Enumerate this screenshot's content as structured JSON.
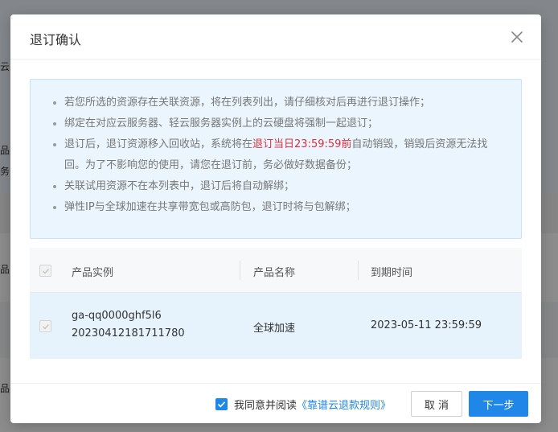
{
  "background": {
    "fragments": [
      "云图",
      "品类",
      "务",
      "品",
      "品类"
    ]
  },
  "dialog": {
    "title": "退订确认",
    "close_icon": "close-icon",
    "notice": {
      "items": [
        {
          "text": "若您所选的资源存在关联资源，将在列表列出，请仔细核对后再进行退订操作；"
        },
        {
          "text": "绑定在对应云服务器、轻云服务器实例上的云硬盘将强制一起退订；"
        },
        {
          "text_before": "退订后，退订资源移入回收站，系统将在",
          "highlight": "退订当日23:59:59前",
          "text_after": "自动销毁，销毁后资源无法找回。为了不影响您的使用，请您在退订前，务必做好数据备份；",
          "highlight_color": "#e0303a"
        },
        {
          "text": "关联试用资源不在本列表中，退订后将自动解绑；"
        },
        {
          "text": "弹性IP与全球加速在共享带宽包或高防包，退订时将与包解绑；"
        }
      ]
    },
    "table": {
      "columns": [
        "产品实例",
        "产品名称",
        "到期时间"
      ],
      "rows": [
        {
          "instance_line1": "ga-qq0000ghf5l6",
          "instance_line2": "20230412181711780",
          "product": "全球加速",
          "expire": "2023-05-11 23:59:59"
        }
      ]
    },
    "footer": {
      "agree_text": "我同意并阅读",
      "agree_link": "《靠谱云退款规则》",
      "cancel_label": "取 消",
      "next_label": "下一步"
    }
  },
  "colors": {
    "accent": "#1f87e8",
    "notice_bg": "#eaf5fd",
    "row_selected": "#e6f3fc",
    "highlight": "#e0303a"
  }
}
